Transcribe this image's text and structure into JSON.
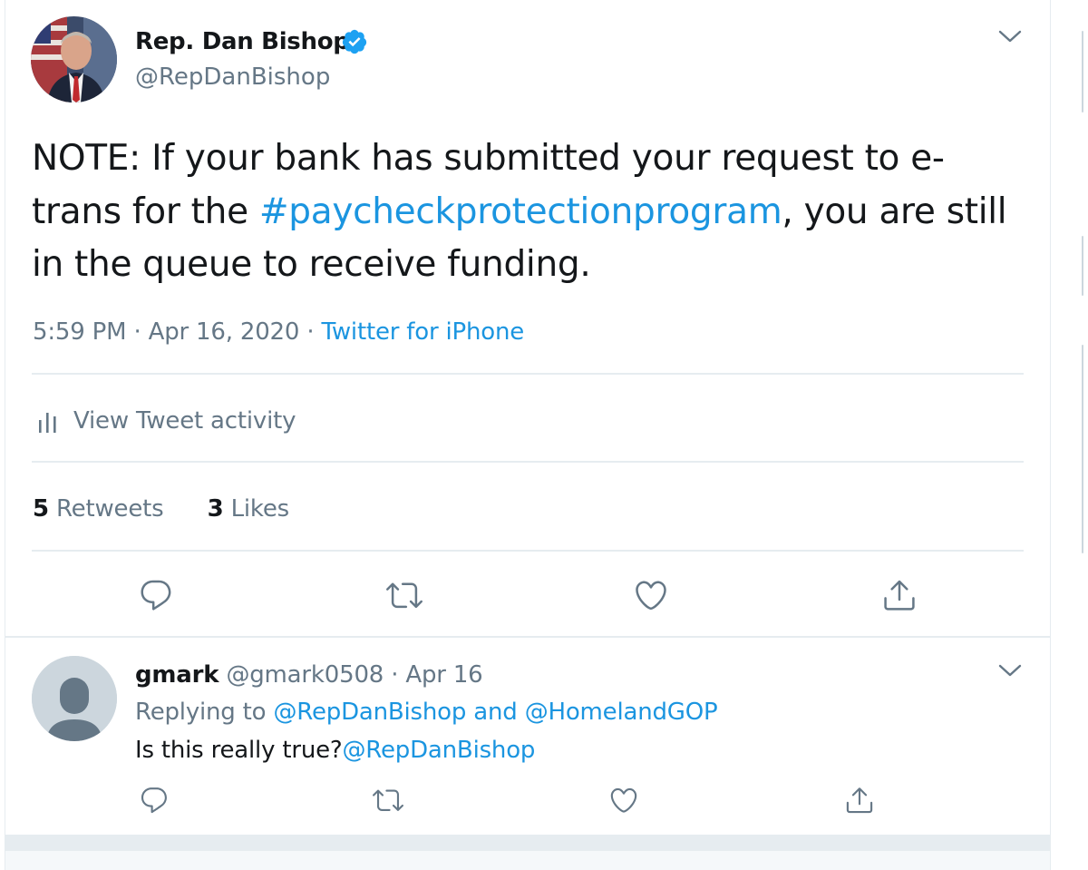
{
  "tweet": {
    "display_name": "Rep. Dan Bishop",
    "verified_icon": "verified-badge-icon",
    "handle": "@RepDanBishop",
    "text_before": "NOTE: If your bank has submitted your request to e-",
    "text_line2_before": "trans for the ",
    "hashtag": "#paycheckprotectionprogram",
    "text_line2_after": ", you are still",
    "text_line3": "in the queue to receive funding.",
    "time": "5:59 PM",
    "separator": "·",
    "date": "Apr 16, 2020",
    "source": "Twitter for iPhone",
    "activity_label": "View Tweet activity",
    "retweets_count": "5",
    "retweets_label": "Retweets",
    "likes_count": "3",
    "likes_label": "Likes"
  },
  "reply": {
    "name": "gmark",
    "handle": "@gmark0508",
    "separator": "·",
    "date": "Apr 16",
    "replying_prefix": "Replying to",
    "replying_user1": "@RepDanBishop",
    "replying_and": "and",
    "replying_user2": "@HomelandGOP",
    "text": "Is this really true?",
    "mention": "@RepDanBishop"
  },
  "icons": {
    "reply": "reply-icon",
    "retweet": "retweet-icon",
    "like": "heart-icon",
    "share": "share-icon",
    "caret": "chevron-down-icon",
    "activity": "bar-chart-icon"
  },
  "colors": {
    "link": "#1b95e0",
    "secondary_text": "#657786",
    "primary_text": "#14171a",
    "divider": "#e6ecf0",
    "verified": "#1da1f2"
  }
}
